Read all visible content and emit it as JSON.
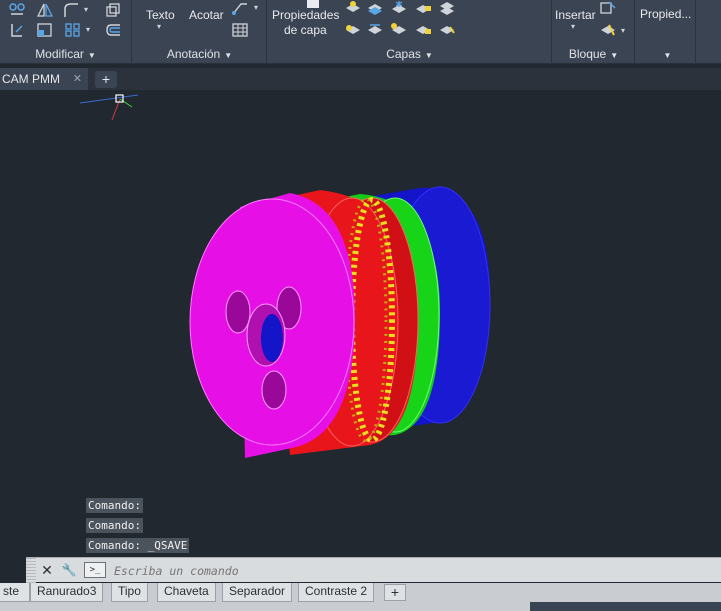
{
  "ribbon": {
    "panels": [
      {
        "title": "Modificar"
      },
      {
        "title": "Anotación"
      },
      {
        "title": "Capas"
      },
      {
        "title": "Bloque"
      },
      {
        "title": ""
      }
    ],
    "buttons": {
      "texto": "Texto",
      "acotar": "Acotar",
      "propiedades_capa_line1": "Propiedades",
      "propiedades_capa_line2": "de capa",
      "insertar": "Insertar",
      "propiedades": "Propied..."
    }
  },
  "tabs": {
    "document": "CAM PMM",
    "close_glyph": "✕",
    "add_glyph": "+"
  },
  "command_history": [
    "Comando:",
    "Comando:",
    "Comando: _QSAVE"
  ],
  "command_line": {
    "placeholder": "Escriba un comando",
    "close_glyph": "✕",
    "customize_glyph": "🔧"
  },
  "layout_tabs": [
    "ste",
    "Ranurado3",
    "Tipo",
    "Chaveta",
    "Separador",
    "Contraste 2"
  ],
  "layout_add_glyph": "+",
  "colors": {
    "magenta_part": "#e60fe6",
    "red_part": "#e8161a",
    "yellow_teeth": "#e8e01e",
    "green_part": "#15cc15",
    "blue_part": "#1414c8",
    "viewport_bg": "#212830"
  }
}
